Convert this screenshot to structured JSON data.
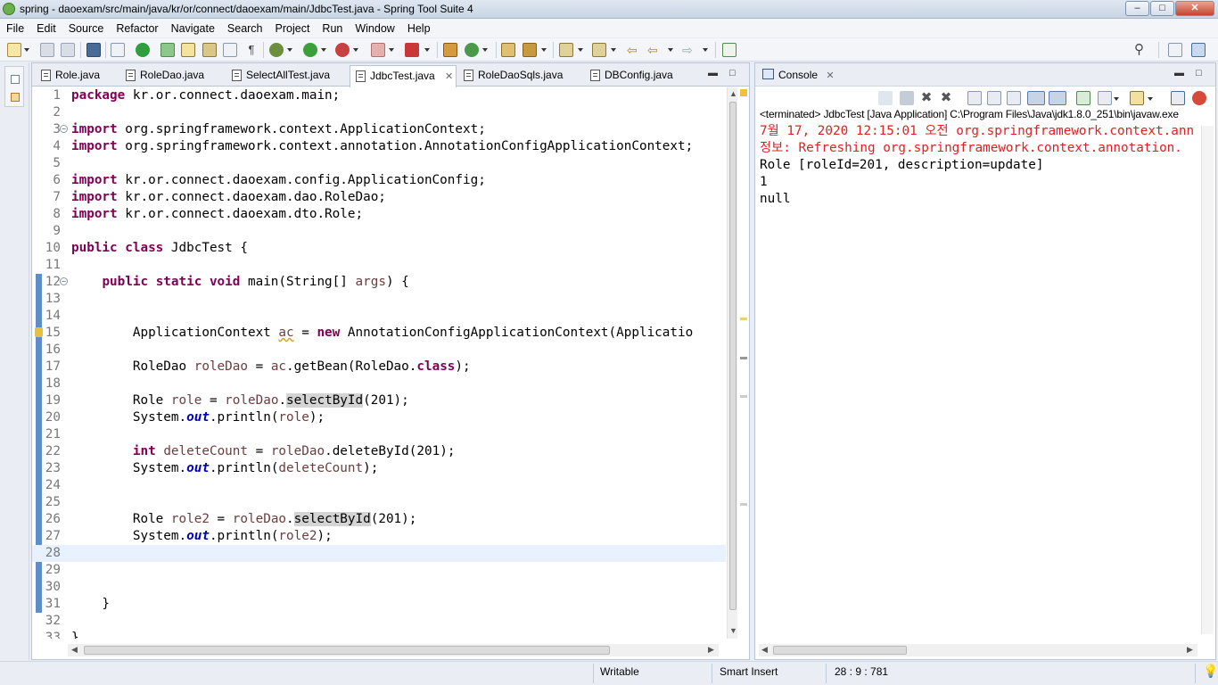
{
  "window": {
    "title": "spring - daoexam/src/main/java/kr/or/connect/daoexam/main/JdbcTest.java - Spring Tool Suite 4",
    "controls": [
      "–",
      "□",
      "✕"
    ]
  },
  "menu": [
    "File",
    "Edit",
    "Source",
    "Refactor",
    "Navigate",
    "Search",
    "Project",
    "Run",
    "Window",
    "Help"
  ],
  "editor_tabs": [
    {
      "label": "Role.java",
      "active": false
    },
    {
      "label": "RoleDao.java",
      "active": false
    },
    {
      "label": "SelectAllTest.java",
      "active": false
    },
    {
      "label": "JdbcTest.java",
      "active": true
    },
    {
      "label": "RoleDaoSqls.java",
      "active": false
    },
    {
      "label": "DBConfig.java",
      "active": false
    }
  ],
  "code_lines": [
    {
      "n": "1",
      "text": "package kr.or.connect.daoexam.main;"
    },
    {
      "n": "2",
      "text": ""
    },
    {
      "n": "3",
      "text": "import org.springframework.context.ApplicationContext;"
    },
    {
      "n": "4",
      "text": "import org.springframework.context.annotation.AnnotationConfigApplicationContext;"
    },
    {
      "n": "5",
      "text": ""
    },
    {
      "n": "6",
      "text": "import kr.or.connect.daoexam.config.ApplicationConfig;"
    },
    {
      "n": "7",
      "text": "import kr.or.connect.daoexam.dao.RoleDao;"
    },
    {
      "n": "8",
      "text": "import kr.or.connect.daoexam.dto.Role;"
    },
    {
      "n": "9",
      "text": ""
    },
    {
      "n": "10",
      "text": "public class JdbcTest {"
    },
    {
      "n": "11",
      "text": ""
    },
    {
      "n": "12",
      "text": "    public static void main(String[] args) {"
    },
    {
      "n": "13",
      "text": ""
    },
    {
      "n": "14",
      "text": ""
    },
    {
      "n": "15",
      "text": "        ApplicationContext ac = new AnnotationConfigApplicationContext(Applicatio"
    },
    {
      "n": "16",
      "text": ""
    },
    {
      "n": "17",
      "text": "        RoleDao roleDao = ac.getBean(RoleDao.class);"
    },
    {
      "n": "18",
      "text": ""
    },
    {
      "n": "19",
      "text": "        Role role = roleDao.selectById(201);"
    },
    {
      "n": "20",
      "text": "        System.out.println(role);"
    },
    {
      "n": "21",
      "text": ""
    },
    {
      "n": "22",
      "text": "        int deleteCount = roleDao.deleteById(201);"
    },
    {
      "n": "23",
      "text": "        System.out.println(deleteCount);"
    },
    {
      "n": "24",
      "text": ""
    },
    {
      "n": "25",
      "text": ""
    },
    {
      "n": "26",
      "text": "        Role role2 = roleDao.selectById(201);"
    },
    {
      "n": "27",
      "text": "        System.out.println(role2);"
    },
    {
      "n": "28",
      "text": ""
    },
    {
      "n": "29",
      "text": ""
    },
    {
      "n": "30",
      "text": ""
    },
    {
      "n": "31",
      "text": "    }"
    },
    {
      "n": "32",
      "text": ""
    },
    {
      "n": "33",
      "text": "}"
    }
  ],
  "console": {
    "tab_label": "Console",
    "path": "<terminated> JdbcTest [Java Application] C:\\Program Files\\Java\\jdk1.8.0_251\\bin\\javaw.exe",
    "lines": [
      {
        "text": "7월 17, 2020 12:15:01 오전 org.springframework.context.ann",
        "color": "#e02020"
      },
      {
        "text": "정보: Refreshing org.springframework.context.annotation.",
        "color": "#e02020"
      },
      {
        "text": "Role [roleId=201, description=update]",
        "color": "#000000"
      },
      {
        "text": "1",
        "color": "#000000"
      },
      {
        "text": "null",
        "color": "#000000"
      }
    ]
  },
  "status": {
    "writable": "Writable",
    "insert_mode": "Smart Insert",
    "position": "28 : 9 : 781"
  },
  "colors": {
    "keyword": "#7f0055",
    "field": "#0000c0",
    "variable": "#6a3e3e",
    "current_line": "#e8f2fe",
    "console_error": "#e02020"
  }
}
